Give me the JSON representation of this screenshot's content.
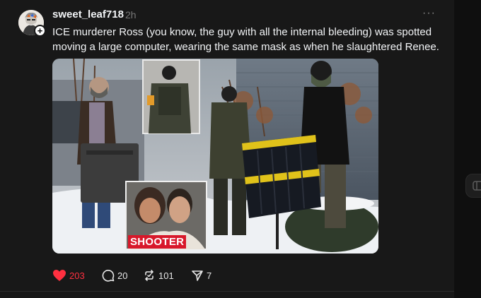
{
  "post": {
    "username": "sweet_leaf718",
    "time": "2h",
    "more": "···",
    "text": "ICE murderer Ross (you know, the guy with all the internal bleeding) was spotted moving a large computer, wearing the same mask as when he slaughtered Renee.",
    "image_caption": "SHOOTER",
    "avatar_plus": "+"
  },
  "actions": {
    "likes": "203",
    "replies": "20",
    "reposts": "101",
    "shares": "7"
  },
  "colors": {
    "background": "#181818",
    "like_active": "#ff3040",
    "text": "#f3f5f7",
    "muted": "#777777",
    "caption_red": "#d8182a"
  },
  "icons": [
    "heart-icon",
    "reply-icon",
    "repost-icon",
    "share-icon",
    "more-icon",
    "plus-icon",
    "side-toggle-icon"
  ]
}
